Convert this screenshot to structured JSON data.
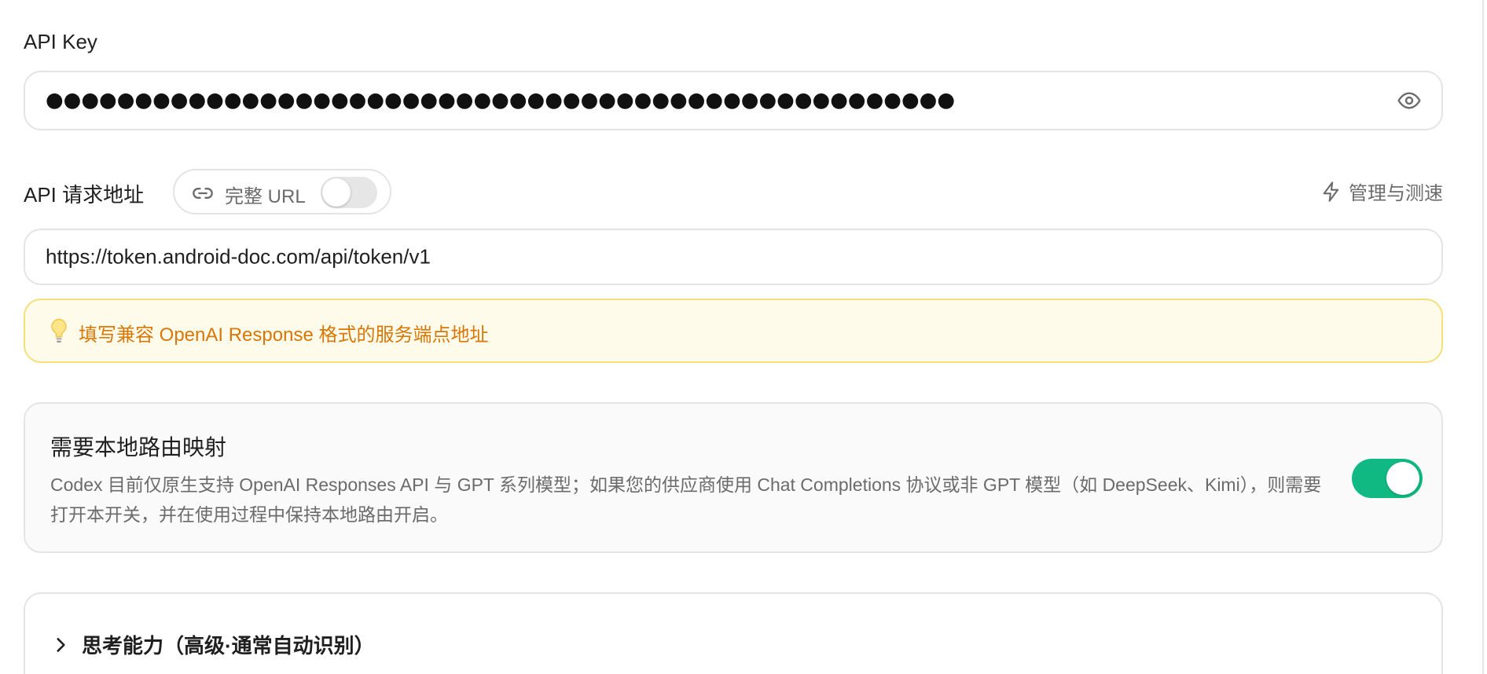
{
  "api_key": {
    "label": "API Key",
    "masked_value": "●●●●●●●●●●●●●●●●●●●●●●●●●●●●●●●●●●●●●●●●●●●●●●●●●●●"
  },
  "endpoint": {
    "label": "API 请求地址",
    "full_url_toggle_label": "完整 URL",
    "full_url_enabled": false,
    "manage_link_label": "管理与测速",
    "value": "https://token.android-doc.com/api/token/v1",
    "hint": "填写兼容 OpenAI Response 格式的服务端点地址"
  },
  "local_routing": {
    "title": "需要本地路由映射",
    "description": "Codex 目前仅原生支持 OpenAI Responses API 与 GPT 系列模型；如果您的供应商使用 Chat Completions 协议或非 GPT 模型（如 DeepSeek、Kimi），则需要打开本开关，并在使用过程中保持本地路由开启。",
    "enabled": true
  },
  "advanced": {
    "title": "思考能力（高级·通常自动识别）"
  },
  "colors": {
    "accent_green": "#10b981",
    "hint_text": "#d97706",
    "hint_bg": "#fffbeb",
    "hint_border": "#f5df7a"
  },
  "icons": [
    "eye-icon",
    "link-icon",
    "zap-icon",
    "lightbulb-icon",
    "chevron-right-icon"
  ]
}
